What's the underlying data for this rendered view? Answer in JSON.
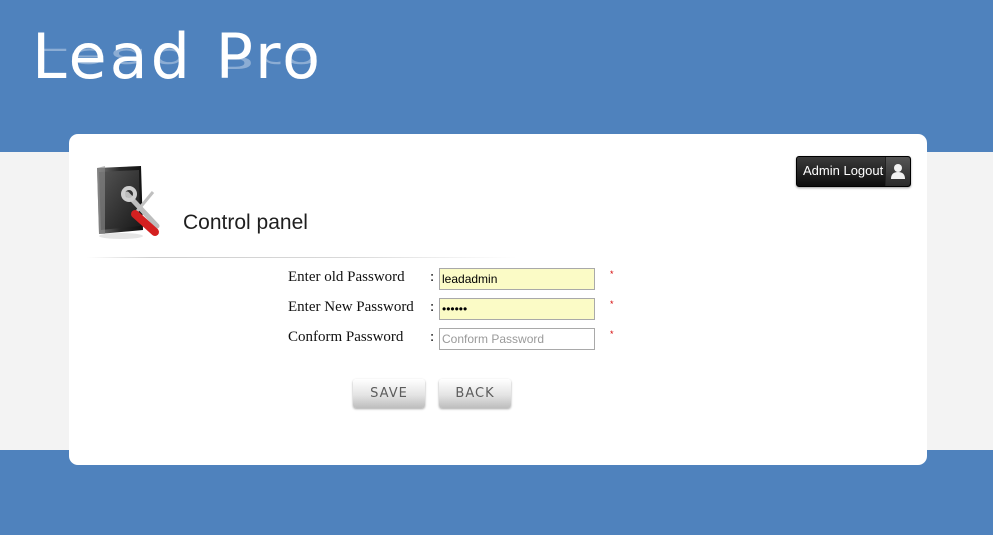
{
  "brand": {
    "logo_text": "Lead Pro"
  },
  "panel": {
    "title": "Control panel"
  },
  "header": {
    "logout_label": "Admin Logout"
  },
  "form": {
    "fields": [
      {
        "label": "Enter old Password",
        "value": "leadadmin",
        "placeholder": "",
        "type": "text",
        "required_mark": "*"
      },
      {
        "label": "Enter New Password",
        "value": "••••••",
        "placeholder": "",
        "type": "password",
        "required_mark": "*"
      },
      {
        "label": "Conform Password",
        "value": "",
        "placeholder": "Conform Password",
        "type": "password",
        "required_mark": "*"
      }
    ],
    "colon": ":",
    "save_label": "SAVE",
    "back_label": "BACK"
  },
  "colors": {
    "header_blue": "#4f82bd",
    "filled_field": "#fbfbc6",
    "required_red": "#d40000"
  },
  "icons": {
    "control_panel": "computer-tools-icon",
    "logout": "user-icon"
  }
}
